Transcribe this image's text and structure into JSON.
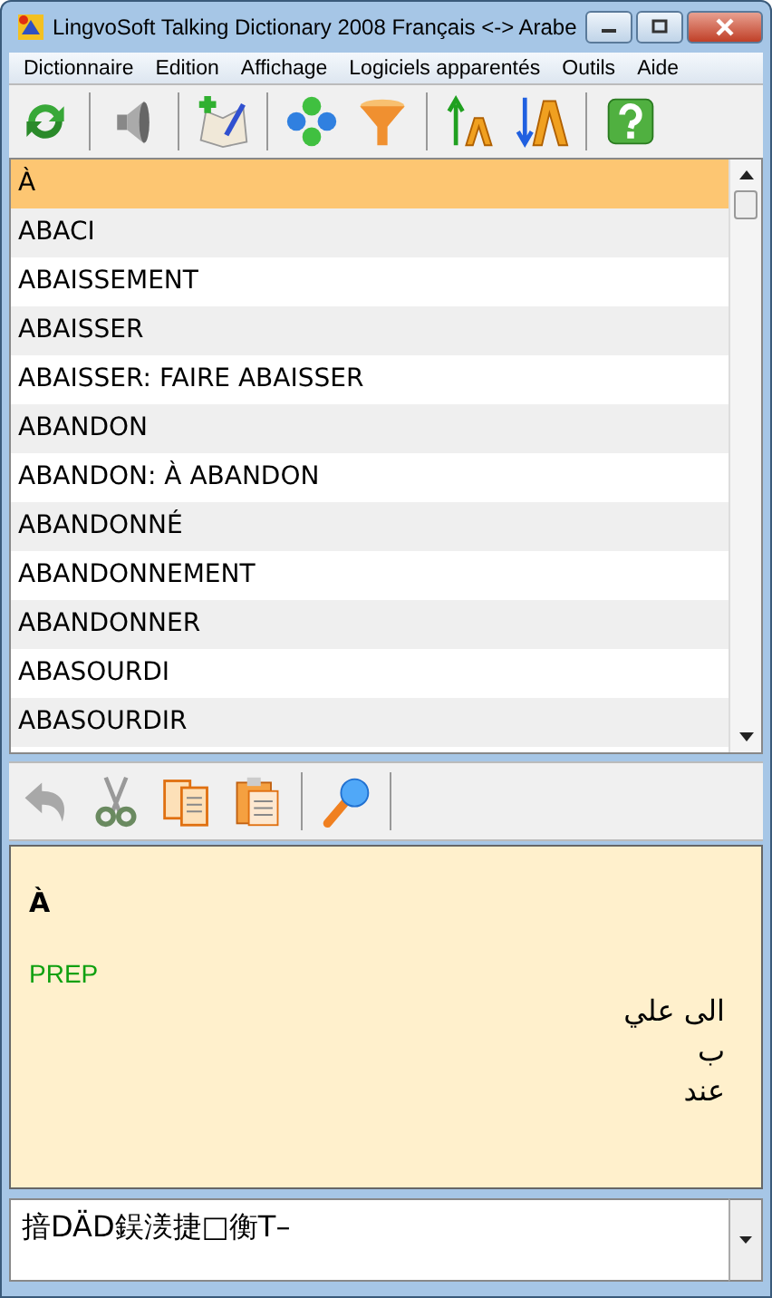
{
  "window": {
    "title": "LingvoSoft Talking Dictionary 2008 Français <-> Arabe"
  },
  "menu": [
    "Dictionnaire",
    "Edition",
    "Affichage",
    "Logiciels apparentés",
    "Outils",
    "Aide"
  ],
  "word_list": [
    {
      "text": "À",
      "selected": true
    },
    {
      "text": "ABACI",
      "selected": false
    },
    {
      "text": "ABAISSEMENT",
      "selected": false
    },
    {
      "text": "ABAISSER",
      "selected": false
    },
    {
      "text": "ABAISSER: FAIRE ABAISSER",
      "selected": false
    },
    {
      "text": "ABANDON",
      "selected": false
    },
    {
      "text": "ABANDON: À ABANDON",
      "selected": false
    },
    {
      "text": "ABANDONNÉ",
      "selected": false
    },
    {
      "text": "ABANDONNEMENT",
      "selected": false
    },
    {
      "text": "ABANDONNER",
      "selected": false
    },
    {
      "text": "ABASOURDI",
      "selected": false
    },
    {
      "text": "ABASOURDIR",
      "selected": false
    }
  ],
  "definition": {
    "headword": "À",
    "part_of_speech": "PREP",
    "translations": [
      "الى علي",
      "ب",
      "عند"
    ]
  },
  "input": {
    "value": "揞DÄD鋘湵捷□衡T–"
  }
}
